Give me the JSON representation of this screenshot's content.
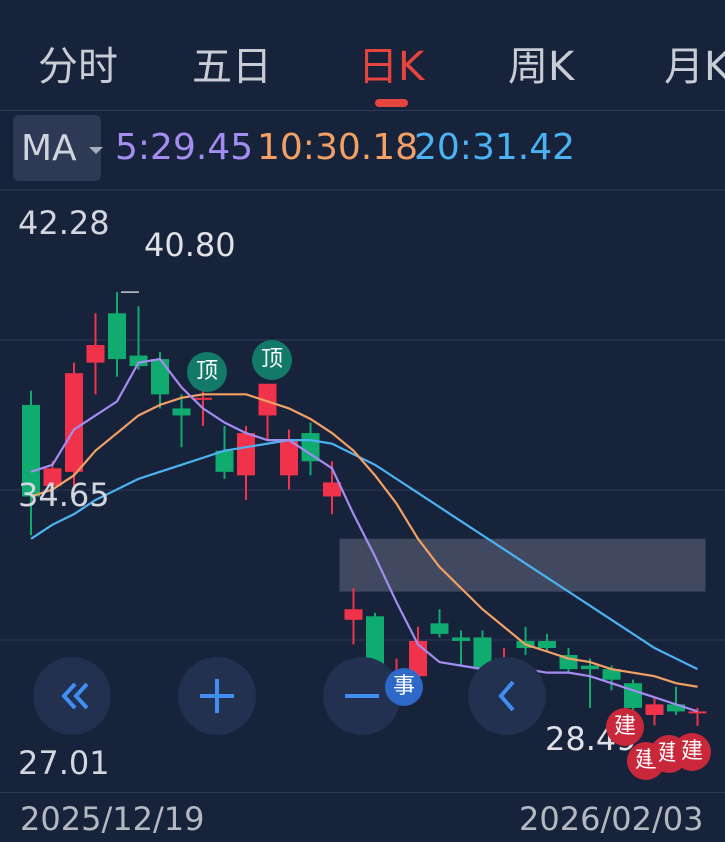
{
  "tabs": [
    {
      "label": "分时",
      "active": false
    },
    {
      "label": "五日",
      "active": false
    },
    {
      "label": "日K",
      "active": true
    },
    {
      "label": "周K",
      "active": false
    },
    {
      "label": "月K",
      "active": false
    }
  ],
  "ma": {
    "selector": "MA",
    "ma5": "5:29.45",
    "ma10": "10:30.18",
    "ma20": "20:31.42",
    "colors": {
      "ma5": "#a48cf0",
      "ma10": "#f2a063",
      "ma20": "#4cb3f2"
    }
  },
  "axis": {
    "top": "42.28",
    "mid": "34.65",
    "bottom": "27.01",
    "start_date": "2025/12/19",
    "end_date": "2026/02/03"
  },
  "markers": {
    "high": "40.80",
    "low": "28.49",
    "top_badge": "顶",
    "news_badge": "事",
    "build_badge": "建"
  },
  "controls": [
    {
      "name": "scroll-left-fast-button",
      "icon": "double-chevron-left-icon"
    },
    {
      "name": "zoom-in-button",
      "icon": "plus-icon"
    },
    {
      "name": "zoom-out-button",
      "icon": "minus-icon"
    },
    {
      "name": "scroll-left-button",
      "icon": "chevron-left-icon"
    }
  ],
  "chart_data": {
    "type": "candlestick",
    "ylim": [
      27.01,
      42.28
    ],
    "colors": {
      "up": "#f0334a",
      "down": "#0fab6f"
    },
    "candles": [
      {
        "o": 37.6,
        "h": 38.0,
        "l": 33.9,
        "c": 35.0
      },
      {
        "o": 35.3,
        "h": 36.0,
        "l": 35.0,
        "c": 35.8
      },
      {
        "o": 35.7,
        "h": 38.8,
        "l": 35.3,
        "c": 38.5
      },
      {
        "o": 38.8,
        "h": 40.2,
        "l": 37.9,
        "c": 39.3
      },
      {
        "o": 40.2,
        "h": 40.8,
        "l": 38.4,
        "c": 38.9
      },
      {
        "o": 39.0,
        "h": 40.4,
        "l": 38.6,
        "c": 38.7
      },
      {
        "o": 38.9,
        "h": 39.1,
        "l": 37.5,
        "c": 37.9
      },
      {
        "o": 37.5,
        "h": 37.9,
        "l": 36.4,
        "c": 37.3
      },
      {
        "o": 37.8,
        "h": 38.4,
        "l": 37.0,
        "c": 37.8
      },
      {
        "o": 36.3,
        "h": 37.0,
        "l": 35.5,
        "c": 35.7
      },
      {
        "o": 35.6,
        "h": 37.0,
        "l": 34.9,
        "c": 36.8
      },
      {
        "o": 37.3,
        "h": 37.9,
        "l": 36.6,
        "c": 38.2
      },
      {
        "o": 35.6,
        "h": 36.9,
        "l": 35.2,
        "c": 36.6
      },
      {
        "o": 36.8,
        "h": 37.1,
        "l": 35.6,
        "c": 36.0
      },
      {
        "o": 35.0,
        "h": 36.0,
        "l": 34.5,
        "c": 35.4
      },
      {
        "o": 31.5,
        "h": 32.4,
        "l": 30.8,
        "c": 31.8
      },
      {
        "o": 31.6,
        "h": 31.7,
        "l": 29.8,
        "c": 29.9
      },
      {
        "o": 29.7,
        "h": 30.4,
        "l": 29.6,
        "c": 30.0
      },
      {
        "o": 29.9,
        "h": 31.3,
        "l": 29.7,
        "c": 30.9
      },
      {
        "o": 31.4,
        "h": 31.8,
        "l": 31.0,
        "c": 31.1
      },
      {
        "o": 31.0,
        "h": 31.2,
        "l": 30.2,
        "c": 30.9
      },
      {
        "o": 31.0,
        "h": 31.2,
        "l": 29.9,
        "c": 30.1
      },
      {
        "o": 29.8,
        "h": 30.7,
        "l": 29.6,
        "c": 30.4
      },
      {
        "o": 30.9,
        "h": 31.3,
        "l": 30.5,
        "c": 30.7
      },
      {
        "o": 30.9,
        "h": 31.1,
        "l": 30.6,
        "c": 30.7
      },
      {
        "o": 30.5,
        "h": 30.7,
        "l": 30.0,
        "c": 30.1
      },
      {
        "o": 30.2,
        "h": 30.4,
        "l": 29.0,
        "c": 30.1
      },
      {
        "o": 30.1,
        "h": 30.2,
        "l": 29.5,
        "c": 29.8
      },
      {
        "o": 29.7,
        "h": 29.8,
        "l": 28.6,
        "c": 29.0
      },
      {
        "o": 28.8,
        "h": 29.3,
        "l": 28.5,
        "c": 29.1
      },
      {
        "o": 29.1,
        "h": 29.6,
        "l": 28.8,
        "c": 28.9
      },
      {
        "o": 28.9,
        "h": 29.0,
        "l": 28.49,
        "c": 28.9
      }
    ],
    "ma5": [
      35.7,
      35.9,
      36.9,
      37.3,
      37.7,
      38.8,
      38.9,
      38.1,
      37.5,
      37.1,
      36.8,
      36.6,
      36.6,
      36.2,
      35.8,
      34.5,
      33.3,
      32.0,
      30.8,
      30.3,
      30.2,
      30.1,
      30.1,
      30.1,
      30.0,
      30.0,
      29.9,
      29.7,
      29.5,
      29.3,
      29.1,
      28.9
    ],
    "ma10": [
      35.0,
      35.2,
      35.6,
      36.3,
      36.8,
      37.3,
      37.6,
      37.8,
      37.9,
      37.9,
      37.9,
      37.7,
      37.5,
      37.2,
      36.8,
      36.3,
      35.6,
      34.8,
      33.8,
      33.0,
      32.4,
      31.8,
      31.3,
      30.8,
      30.6,
      30.4,
      30.3,
      30.1,
      30.0,
      29.9,
      29.7,
      29.6
    ],
    "ma20": [
      33.8,
      34.2,
      34.5,
      34.9,
      35.2,
      35.5,
      35.7,
      35.9,
      36.1,
      36.3,
      36.4,
      36.5,
      36.6,
      36.6,
      36.5,
      36.2,
      35.9,
      35.5,
      35.1,
      34.7,
      34.3,
      33.9,
      33.5,
      33.1,
      32.7,
      32.3,
      31.9,
      31.5,
      31.1,
      30.7,
      30.4,
      30.1
    ],
    "highlight_band": {
      "from_index": 15,
      "to_index": 31,
      "y_from": 32.3,
      "y_to": 33.8
    }
  }
}
